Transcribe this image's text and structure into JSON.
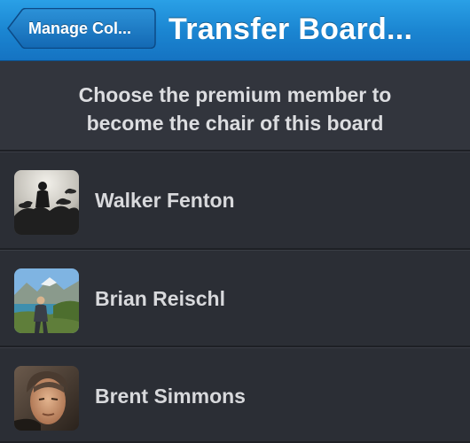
{
  "navbar": {
    "back_label": "Manage Col...",
    "title": "Transfer Board..."
  },
  "instructions": {
    "line1": "Choose the premium member to",
    "line2": "become the chair of this board"
  },
  "members": [
    {
      "name": "Walker Fenton"
    },
    {
      "name": "Brian Reischl"
    },
    {
      "name": "Brent Simmons"
    }
  ],
  "colors": {
    "navbar_blue": "#1b86d2",
    "background": "#2b2e35",
    "text": "#d8d9dc"
  }
}
